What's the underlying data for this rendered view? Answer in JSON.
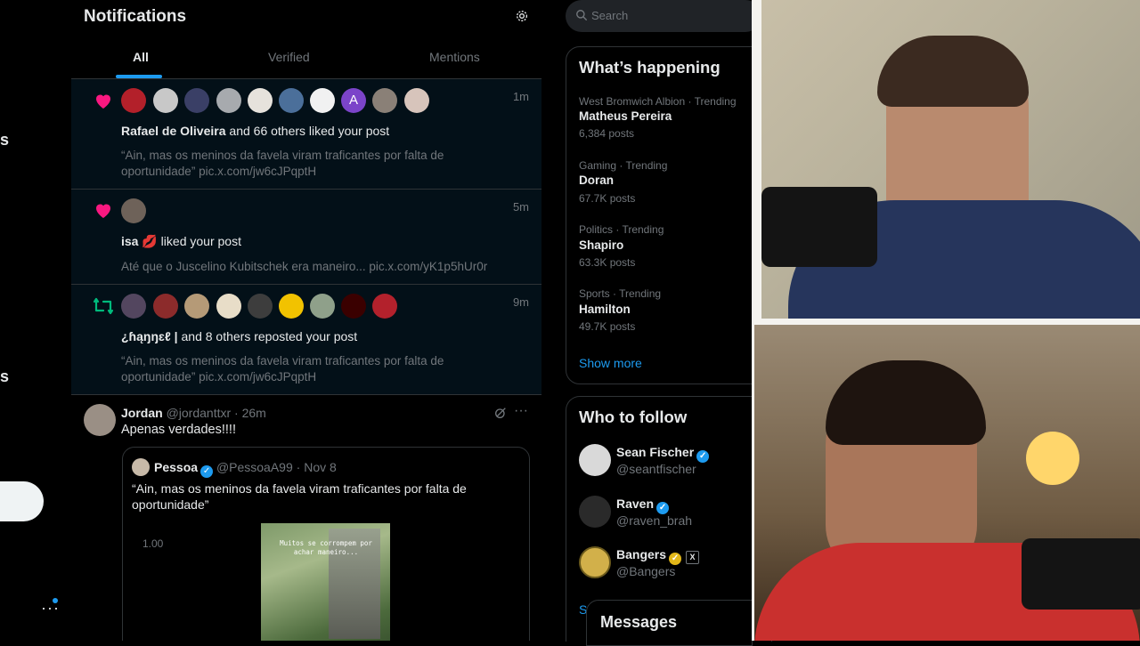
{
  "leftnav": {
    "partial_label_1": "s",
    "partial_label_2": "s",
    "more_icon": "more-dots-icon"
  },
  "header": {
    "title": "Notifications",
    "settings_icon": "gear-icon"
  },
  "tabs": [
    {
      "label": "All",
      "active": true
    },
    {
      "label": "Verified",
      "active": false
    },
    {
      "label": "Mentions",
      "active": false
    }
  ],
  "notifications": [
    {
      "type": "like",
      "icon": "heart-icon",
      "time": "1m",
      "actor": "Rafael de Oliveira",
      "action": " and 66 others liked your post",
      "text": "“Ain, mas os meninos da favela viram traficantes por falta de oportunidade” pic.x.com/jw6cJPqptH",
      "avatar_letter": "A"
    },
    {
      "type": "like",
      "icon": "heart-icon",
      "time": "5m",
      "actor": "isa 💋",
      "action": " liked your post",
      "text": "Até que o Juscelino Kubitschek era maneiro... pic.x.com/yK1p5hUr0r"
    },
    {
      "type": "repost",
      "icon": "repost-icon",
      "time": "9m",
      "actor": "¿ɦąŋŋɛℓ |",
      "action": " and 8 others reposted your post",
      "text": "“Ain, mas os meninos da favela viram traficantes por falta de oportunidade” pic.x.com/jw6cJPqptH"
    }
  ],
  "tweet": {
    "name": "Jordan",
    "handle": "@jordanttxr",
    "time": "· 26m",
    "text": "Apenas verdades!!!!",
    "quote": {
      "name": "Pessoa",
      "handle": "@PessoaA99",
      "time": "· Nov 8",
      "text": "“Ain, mas os meninos da favela viram traficantes por falta de oportunidade”",
      "media_speed": "1.00",
      "media_caption": "Muitos se corrompem por achar maneiro..."
    }
  },
  "search": {
    "placeholder": "Search"
  },
  "whats_happening": {
    "title": "What’s happening",
    "items": [
      {
        "meta": "West Bromwich Albion · Trending",
        "title": "Matheus Pereira",
        "posts": "6,384 posts"
      },
      {
        "meta": "Gaming · Trending",
        "title": "Doran",
        "posts": "67.7K posts"
      },
      {
        "meta": "Politics · Trending",
        "title": "Shapiro",
        "posts": "63.3K posts"
      },
      {
        "meta": "Sports · Trending",
        "title": "Hamilton",
        "posts": "49.7K posts"
      }
    ],
    "show_more": "Show more"
  },
  "who_to_follow": {
    "title": "Who to follow",
    "items": [
      {
        "name": "Sean Fischer",
        "handle": "@seantfischer",
        "badge": "blue"
      },
      {
        "name": "Raven",
        "handle": "@raven_brah",
        "badge": "blue"
      },
      {
        "name": "Bangers",
        "handle": "@Bangers",
        "badge": "gold"
      }
    ],
    "show_more_partial": "Sh"
  },
  "messages": {
    "title": "Messages"
  },
  "colors": {
    "accent": "#1d9bf0",
    "like": "#f91880",
    "repost": "#00ba7c",
    "bg": "#000000"
  }
}
